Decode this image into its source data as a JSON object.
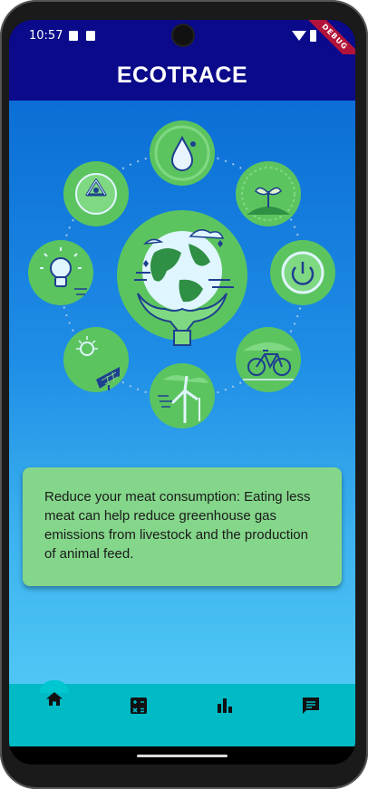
{
  "status_bar": {
    "time": "10:57",
    "debug_label": "DEBUG"
  },
  "app_bar": {
    "title": "ECOTRACE"
  },
  "illustration": {
    "icons": [
      "water-drop-icon",
      "sprout-icon",
      "power-icon",
      "bicycle-icon",
      "wind-turbine-icon",
      "solar-panel-icon",
      "light-bulb-icon",
      "recycle-icon",
      "earth-in-hands-icon"
    ]
  },
  "tip_card": {
    "text": "Reduce your meat consumption: Eating less meat can help reduce greenhouse gas emissions from livestock and the production of animal feed."
  },
  "bottom_nav": {
    "items": [
      {
        "icon": "home-icon",
        "selected": true
      },
      {
        "icon": "calculator-icon",
        "selected": false
      },
      {
        "icon": "bar-chart-icon",
        "selected": false
      },
      {
        "icon": "chat-icon",
        "selected": false
      }
    ]
  },
  "colors": {
    "app_bar": "#0a0a8a",
    "bottom_nav": "#00bac6",
    "card": "#84d68a",
    "icon_green": "#5cc45f"
  }
}
